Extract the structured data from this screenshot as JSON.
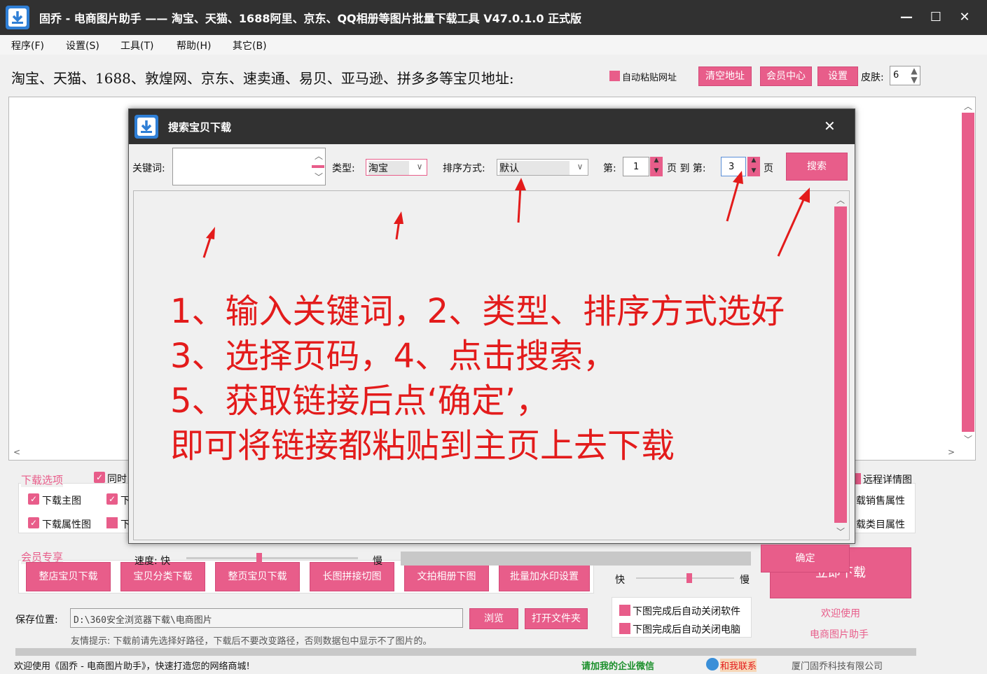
{
  "window": {
    "title": "固乔 - 电商图片助手 —— 淘宝、天猫、1688阿里、京东、QQ相册等图片批量下载工具 V47.0.1.0 正式版",
    "min": "—",
    "max": "☐",
    "close": "✕"
  },
  "menu": [
    "程序(F)",
    "设置(S)",
    "工具(T)",
    "帮助(H)",
    "其它(B)"
  ],
  "url_row": {
    "label": "淘宝、天猫、1688、敦煌网、京东、速卖通、易贝、亚马逊、拼多多等宝贝地址:",
    "auto_paste": "自动粘贴网址",
    "clear_btn": "清空地址",
    "member_btn": "会员中心",
    "settings_btn": "设置",
    "skin_label": "皮肤:",
    "skin_value": "6"
  },
  "download_options": {
    "title": "下载选项",
    "same_time": "同时",
    "main_img": "下载主图",
    "main_img_second": "下",
    "prop_img": "下载属性图",
    "prop_img_second": "下",
    "remote_detail": "远程详情图",
    "sales_prop": "载销售属性",
    "category_prop": "载类目属性"
  },
  "member": {
    "title": "会员专享",
    "buttons": [
      "整店宝贝下载",
      "宝贝分类下载",
      "整页宝贝下载",
      "长图拼接切图",
      "文拍相册下图",
      "批量加水印设置"
    ]
  },
  "speed_fast": "快",
  "speed_slow": "慢",
  "save": {
    "label": "保存位置:",
    "path": "D:\\360安全浏览器下载\\电商图片",
    "browse": "浏览",
    "open_folder": "打开文件夹",
    "tip": "友情提示: 下载前请先选择好路径，下载后不要改变路径，否则数据包中显示不了图片的。"
  },
  "after_download": {
    "close_software": "下图完成后自动关闭软件",
    "close_pc": "下图完成后自动关闭电脑"
  },
  "start_btn": "立即下载",
  "welcome": {
    "line1": "欢迎使用",
    "line2": "电商图片助手"
  },
  "status": {
    "left": "欢迎使用《固乔 - 电商图片助手》，快速打造您的网络商城!",
    "wechat": "请加我的企业微信",
    "contact": "和我联系",
    "company": "厦门固乔科技有限公司"
  },
  "dialog": {
    "title": "搜索宝贝下载",
    "close": "✕",
    "keyword_label": "关键词:",
    "keyword_value": "",
    "type_label": "类型:",
    "type_value": "淘宝",
    "sort_label": "排序方式:",
    "sort_value": "默认",
    "page_from_label": "第:",
    "page_from": "1",
    "page_to_label": "页 到 第:",
    "page_to": "3",
    "page_suffix": "页",
    "search_btn": "搜索",
    "speed_label": "速度: 快",
    "speed_slow": "慢",
    "speed_level": 0.42,
    "confirm_btn": "确定"
  },
  "instructions": [
    "1、输入关键词，2、类型、排序方式选好",
    "3、选择页码，4、点击搜索，",
    "5、获取链接后点‘确定’，",
    "即可将链接都粘贴到主页上去下载"
  ],
  "colors": {
    "accent": "#e85d8a",
    "titlebar": "#313131",
    "annotation": "#e31b1b"
  }
}
